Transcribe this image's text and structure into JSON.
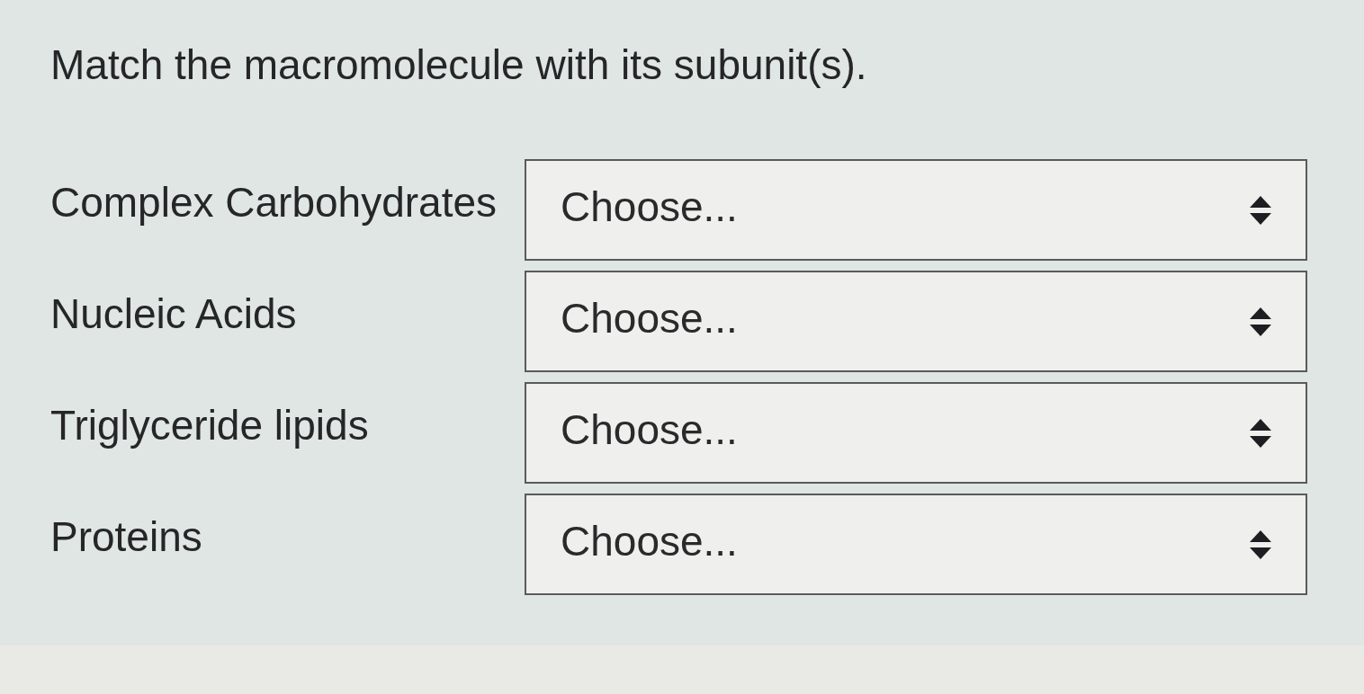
{
  "question": {
    "prompt": "Match the macromolecule with its subunit(s).",
    "rows": [
      {
        "term": "Complex Carbohydrates",
        "select": {
          "placeholder": "Choose..."
        }
      },
      {
        "term": "Nucleic Acids",
        "select": {
          "placeholder": "Choose..."
        }
      },
      {
        "term": "Triglyceride lipids",
        "select": {
          "placeholder": "Choose..."
        }
      },
      {
        "term": "Proteins",
        "select": {
          "placeholder": "Choose..."
        }
      }
    ]
  }
}
